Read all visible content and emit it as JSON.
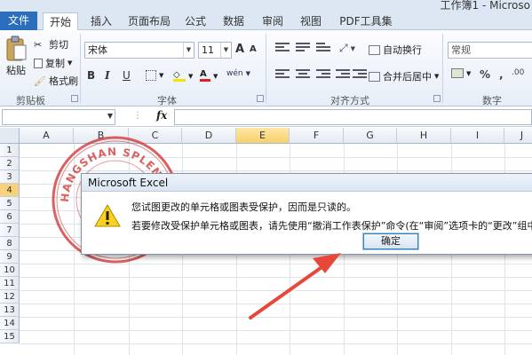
{
  "window": {
    "title": "工作簿1 - Microso"
  },
  "tabs": [
    {
      "label": "文件"
    },
    {
      "label": "开始"
    },
    {
      "label": "插入"
    },
    {
      "label": "页面布局"
    },
    {
      "label": "公式"
    },
    {
      "label": "数据"
    },
    {
      "label": "审阅"
    },
    {
      "label": "视图"
    },
    {
      "label": "PDF工具集"
    }
  ],
  "ribbon": {
    "clipboard": {
      "paste": "粘贴",
      "cut": "剪切",
      "copy": "复制",
      "format_painter": "格式刷",
      "label": "剪贴板"
    },
    "font": {
      "name": "宋体",
      "size": "11",
      "label": "字体",
      "bold": "B",
      "italic": "I",
      "underline": "U",
      "grow": "A",
      "shrink": "A",
      "wen": "wén"
    },
    "alignment": {
      "wrap": "自动换行",
      "merge": "合并后居中",
      "label": "对齐方式"
    },
    "number": {
      "format": "常规",
      "label": "数字"
    }
  },
  "formula_bar": {
    "fx": "fx",
    "name_box": ""
  },
  "grid": {
    "columns": [
      "A",
      "B",
      "C",
      "D",
      "E",
      "F",
      "G",
      "H",
      "I",
      "J"
    ],
    "selected_column": "E",
    "rows": [
      "1",
      "2",
      "3",
      "4",
      "5",
      "6",
      "7",
      "8",
      "9",
      "10",
      "11",
      "12",
      "13",
      "14",
      "15"
    ],
    "selected_row": "4"
  },
  "stamp": {
    "text": "HANGSHAN SPLENDID LOGIS"
  },
  "dialog": {
    "title": "Microsoft Excel",
    "message1": "您试图更改的单元格或图表受保护，因而是只读的。",
    "message2": "若要修改受保护单元格或图表，请先使用“撤消工作表保护”命令(在“审阅”选项卡的“更改”组中",
    "ok": "确定"
  },
  "colors": {
    "file_tab": "#2a6ebc",
    "arrow": "#e8483a",
    "stamp": "#d23a3a",
    "selected_header": "#f8cf6a"
  }
}
